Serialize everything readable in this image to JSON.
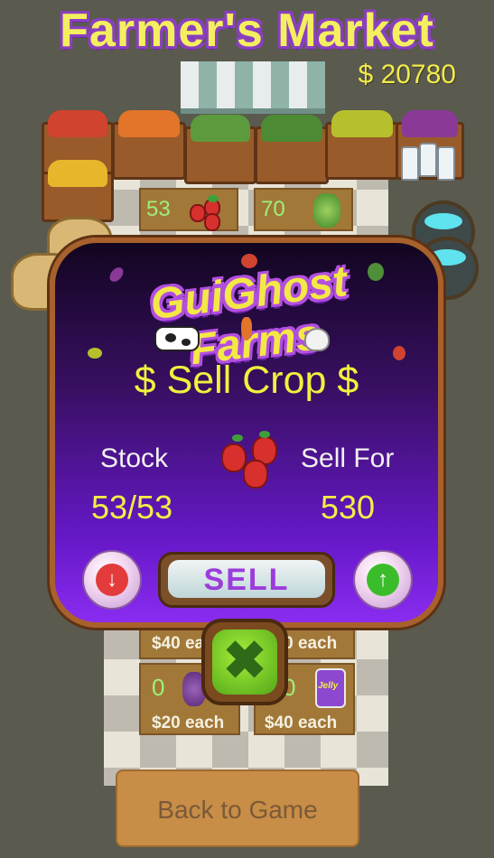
{
  "header": {
    "title": "Farmer's Market",
    "money": "$ 20780"
  },
  "stalls_top": [
    {
      "count": "53",
      "icon": "strawberry-icon"
    },
    {
      "count": "70",
      "icon": "lettuce-icon"
    }
  ],
  "stalls_bottom": [
    {
      "count": "",
      "price": "$40 each",
      "icon": "blank"
    },
    {
      "count": "",
      "price": "$40 each",
      "icon": "blank"
    },
    {
      "count": "0",
      "price": "$20 each",
      "icon": "grapes-icon"
    },
    {
      "count": "0",
      "price": "$40 each",
      "icon": "jelly-jar-icon",
      "jar_label": "Jelly"
    }
  ],
  "sell_modal": {
    "brand": "GuiGhost Farms",
    "heading": "$ Sell Crop $",
    "stock_label": "Stock",
    "stock_value": "53/53",
    "sell_for_label": "Sell For",
    "sell_for_value": "530",
    "sell_button": "SELL",
    "crop_icon": "strawberry-icon",
    "decrease_icon": "arrow-down-icon",
    "increase_icon": "arrow-up-icon",
    "close_icon": "close-x-icon"
  },
  "footer": {
    "back_button": "Back to Game"
  },
  "colors": {
    "title": "#f4ef5e",
    "modal_top": "#12061f",
    "modal_bottom": "#8a2cf0",
    "heading": "#f2f03e",
    "decrease": "#e33b3b",
    "increase": "#3bbd2b"
  }
}
